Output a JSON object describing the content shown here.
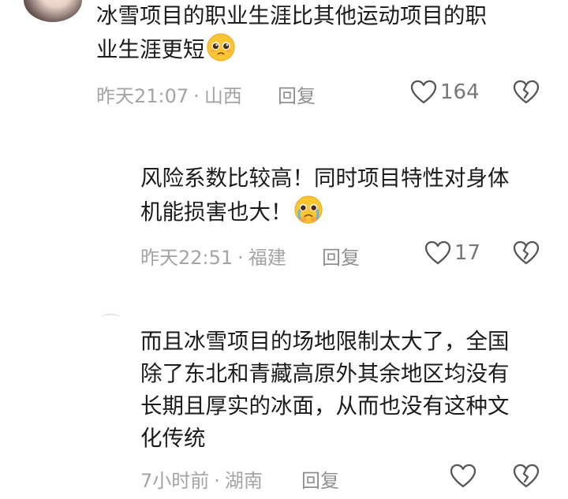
{
  "comments": [
    {
      "text_lines": [
        "冰雪项目的职业生涯比其他运动项目的职",
        "业生涯更短"
      ],
      "emoji": "pleading-face-emoji",
      "time": "昨天21:07",
      "location": "山西",
      "separator": "·",
      "reply_label": "回复",
      "likes": "164"
    },
    {
      "text_lines": [
        "风险系数比较高！同时项目特性对身体",
        "机能损害也大！"
      ],
      "emoji": "crying-face-emoji",
      "time": "昨天22:51",
      "location": "福建",
      "separator": "·",
      "reply_label": "回复",
      "likes": "17"
    },
    {
      "text_lines": [
        "而且冰雪项目的场地限制太大了，全国",
        "除了东北和青藏高原外其余地区均没有",
        "长期且厚实的冰面，从而也没有这种文",
        "化传统"
      ],
      "time": "7小时前",
      "location": "湖南",
      "separator": "·",
      "reply_label": "回复",
      "likes": ""
    }
  ],
  "colors": {
    "text": "#1b1b1b",
    "meta": "#a4a4a4",
    "icon": "#555555"
  },
  "icons": {
    "like": "heart-outline-icon",
    "dislike": "broken-heart-icon"
  }
}
